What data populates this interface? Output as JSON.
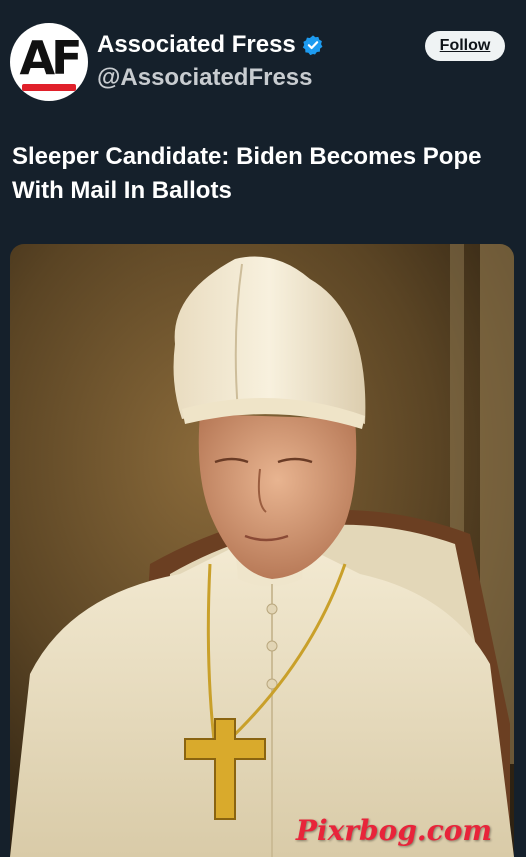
{
  "account": {
    "avatar_text": "AF",
    "display_name": "Associated Fress",
    "handle": "@AssociatedFress",
    "verified": true,
    "verified_color": "#1d9bf0"
  },
  "follow_button": {
    "label": "Follow"
  },
  "post": {
    "headline": "Sleeper Candidate: Biden Becomes Pope With Mail In Ballots",
    "image_description": "Elderly man with eyes closed wearing white papal mitre and cassock with a gold pectoral cross, seated in a wooden chair",
    "watermark": "Pixrbog.com",
    "watermark_color": "#e8243a"
  },
  "theme": {
    "background": "#15202b",
    "text_primary": "#ffffff",
    "text_secondary": "#c8ccd0"
  }
}
